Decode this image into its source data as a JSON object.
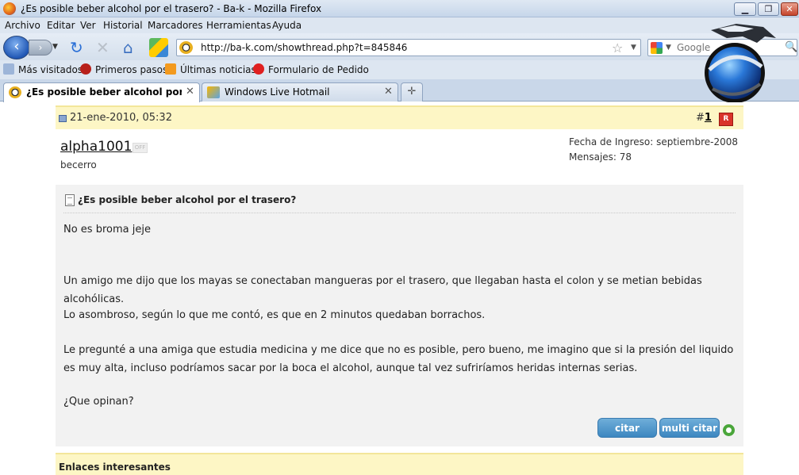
{
  "window": {
    "title": "¿Es posible beber alcohol por el trasero? - Ba-k - Mozilla Firefox",
    "min_label": "▁",
    "max_label": "❐",
    "close_label": "✕"
  },
  "menu": [
    "Archivo",
    "Editar",
    "Ver",
    "Historial",
    "Marcadores",
    "Herramientas",
    "Ayuda"
  ],
  "nav": {
    "url": "http://ba-k.com/showthread.php?t=845846",
    "search_placeholder": "Google"
  },
  "bookmarks": [
    "Más visitados",
    "Primeros pasos",
    "Últimas noticias",
    "Formulario de Pedido"
  ],
  "tabs": [
    {
      "label": "¿Es posible beber alcohol por el tr...",
      "active": true
    },
    {
      "label": "Windows Live Hotmail",
      "active": false
    }
  ],
  "post": {
    "date": "21-ene-2010, 05:32",
    "number_prefix": "#",
    "number": "1",
    "report_label": "R",
    "username": "alpha1001",
    "status_badge": "OFF",
    "user_title": "becerro",
    "join_date": "Fecha de Ingreso: septiembre-2008",
    "posts_count": "Mensajes: 78",
    "title": "¿Es posible beber alcohol por el trasero?",
    "paragraphs": [
      "No es broma jeje",
      "Un amigo me dijo que los mayas se conectaban mangueras por el trasero, que llegaban hasta el colon y se metian bebidas alcohólicas.",
      "Lo asombroso, según lo que me contó, es que en 2 minutos quedaban borrachos.",
      "Le pregunté a una amiga que estudia medicina y me dice que no es posible, pero bueno, me imagino que si la presión del liquido es muy alta, incluso podríamos sacar por la boca el alcohol, aunque tal vez sufriríamos heridas internas serias.",
      "¿Que opinan?"
    ],
    "quote_button": "citar",
    "multiquote_button": "multi citar"
  },
  "links_section": {
    "title": "Enlaces interesantes"
  }
}
